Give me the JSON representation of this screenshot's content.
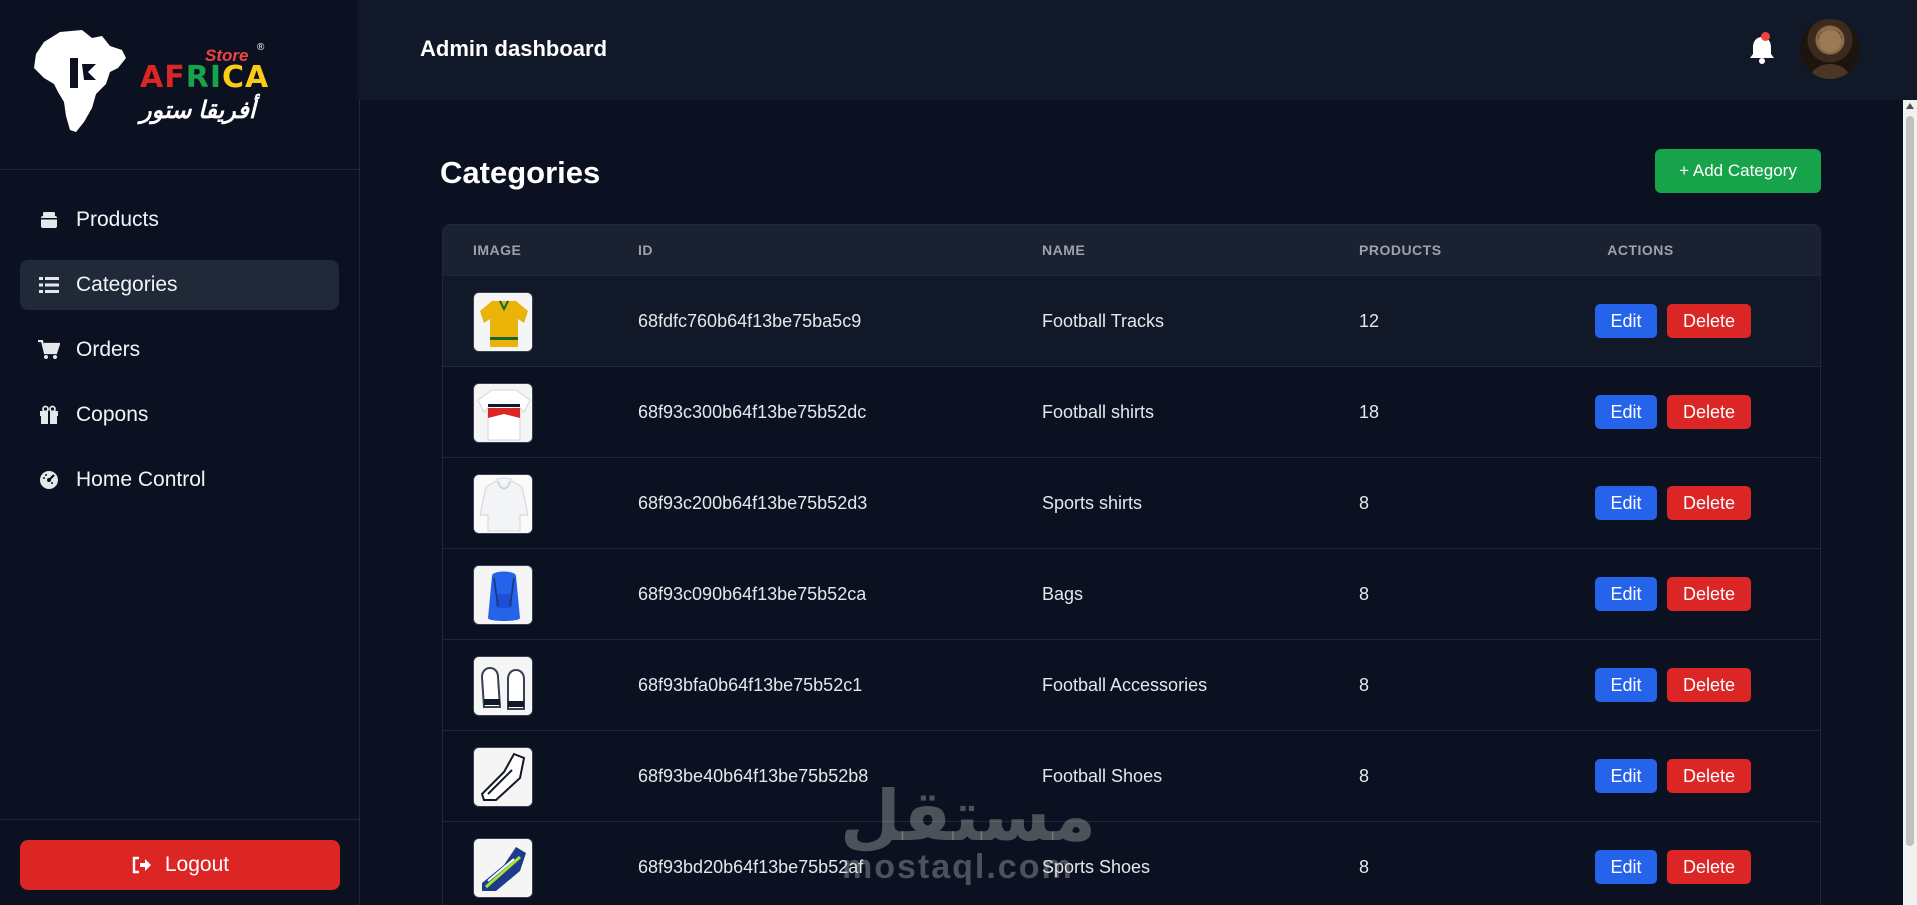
{
  "brand": {
    "store": "Store",
    "reg": "®",
    "africa": [
      "AF",
      "RI",
      "CA"
    ],
    "arabic": "أفريقا ستور"
  },
  "sidebar": {
    "items": [
      {
        "label": "Products",
        "icon": "box-icon"
      },
      {
        "label": "Categories",
        "icon": "list-icon",
        "active": true
      },
      {
        "label": "Orders",
        "icon": "cart-icon"
      },
      {
        "label": "Copons",
        "icon": "gift-icon"
      },
      {
        "label": "Home Control",
        "icon": "gauge-icon"
      }
    ],
    "logout_label": "Logout"
  },
  "header": {
    "title": "Admin dashboard"
  },
  "main": {
    "title": "Categories",
    "add_label": "+ Add Category"
  },
  "table": {
    "columns": [
      "IMAGE",
      "ID",
      "NAME",
      "PRODUCTS",
      "ACTIONS"
    ],
    "rows": [
      {
        "id": "68fdfc760b64f13be75ba5c9",
        "name": "Football Tracks",
        "products": "12",
        "thumb": "yellow-tracksuit"
      },
      {
        "id": "68f93c300b64f13be75b52dc",
        "name": "Football shirts",
        "products": "18",
        "thumb": "white-red-shirt"
      },
      {
        "id": "68f93c200b64f13be75b52d3",
        "name": "Sports shirts",
        "products": "8",
        "thumb": "white-hoodie"
      },
      {
        "id": "68f93c090b64f13be75b52ca",
        "name": "Bags",
        "products": "8",
        "thumb": "blue-backpack"
      },
      {
        "id": "68f93bfa0b64f13be75b52c1",
        "name": "Football Accessories",
        "products": "8",
        "thumb": "goalkeeper-gloves"
      },
      {
        "id": "68f93be40b64f13be75b52b8",
        "name": "Football Shoes",
        "products": "8",
        "thumb": "white-boots"
      },
      {
        "id": "68f93bd20b64f13be75b52af",
        "name": "Sports Shoes",
        "products": "8",
        "thumb": "running-shoes"
      }
    ],
    "edit_label": "Edit",
    "delete_label": "Delete"
  },
  "watermark": {
    "arabic": "مستقل",
    "latin": "mostaql.com"
  },
  "colors": {
    "background": "#0b1120",
    "accent_green": "#16a34a",
    "edit_blue": "#2563eb",
    "delete_red": "#dc2626"
  }
}
